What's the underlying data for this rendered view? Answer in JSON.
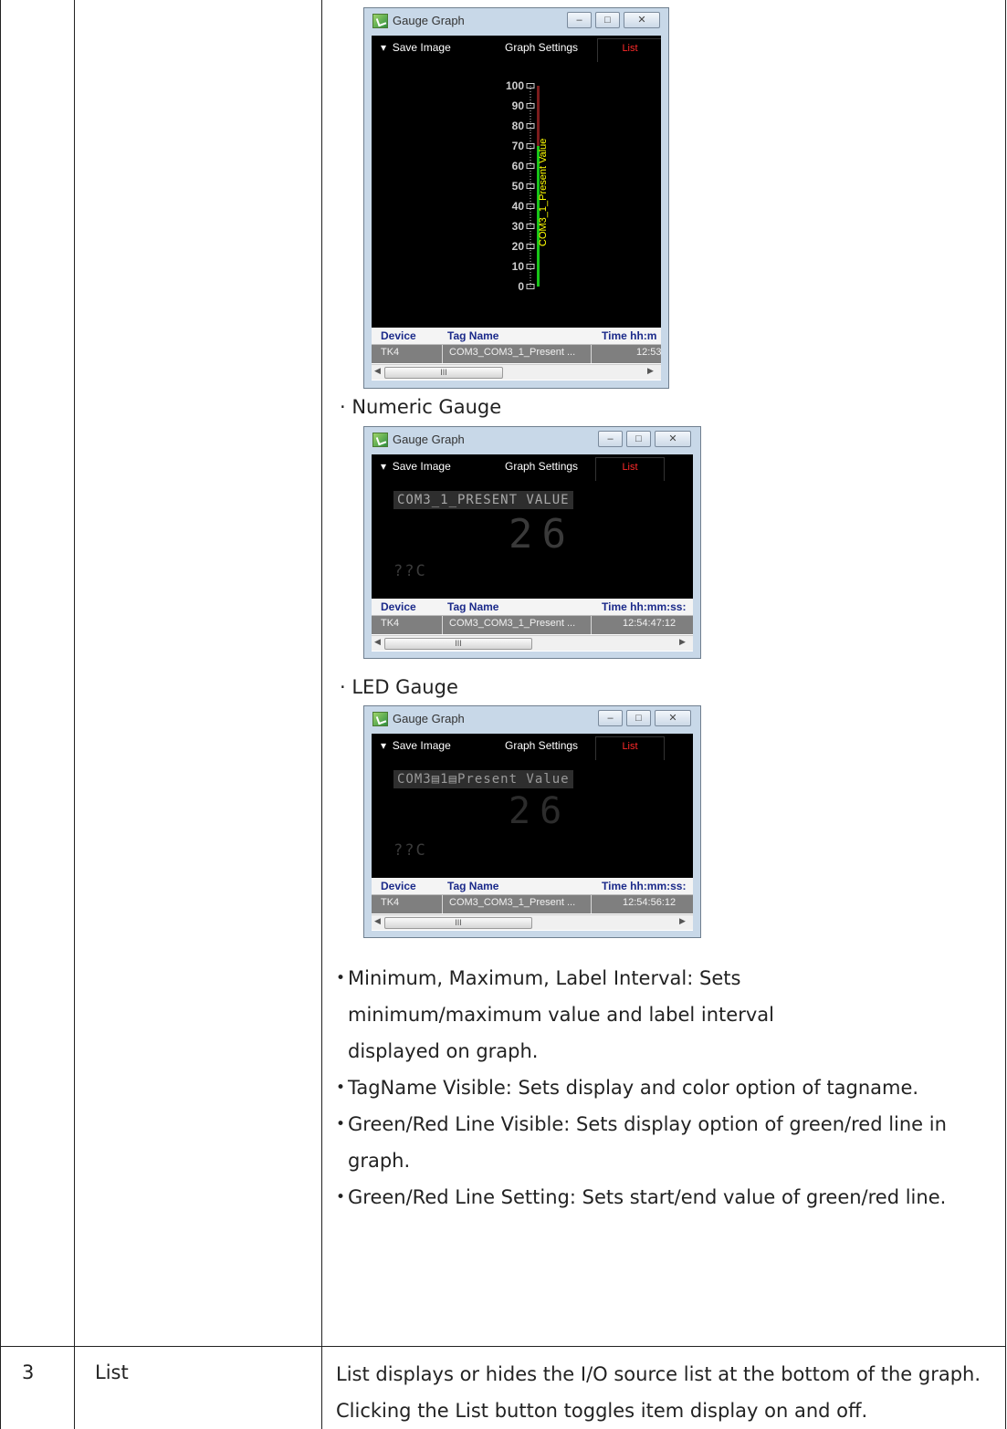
{
  "windows": {
    "title": "Gauge Graph",
    "save_image": "Save Image",
    "graph_settings": "Graph Settings",
    "list_tab": "List",
    "minimize": "–",
    "maximize": "□",
    "close": "✕",
    "col_device": "Device",
    "col_tag": "Tag Name",
    "scroll_thumb": "III",
    "scroll_left": "◀",
    "scroll_right": "▶"
  },
  "bar_gauge": {
    "tick_labels": [
      "100",
      "90",
      "80",
      "70",
      "60",
      "50",
      "40",
      "30",
      "20",
      "10",
      "0"
    ],
    "tag_label": "COM3_1_Present Value",
    "min": 0,
    "max": 100,
    "label_interval": 10,
    "green_line": {
      "start": 0,
      "end": 70
    },
    "red_line": {
      "start": 70,
      "end": 100
    },
    "col_time": "Time hh:m",
    "row": {
      "device": "TK4",
      "tag": "COM3_COM3_1_Present ...",
      "time": "12:53"
    }
  },
  "numeric_gauge": {
    "label": "· Numeric Gauge",
    "tag_display": "COM3_1_PRESENT VALUE",
    "value": "26",
    "unit": "??C",
    "col_time": "Time hh:mm:ss:",
    "row": {
      "device": "TK4",
      "tag": "COM3_COM3_1_Present ...",
      "time": "12:54:47:12"
    }
  },
  "led_gauge": {
    "label": "· LED Gauge",
    "tag_display": "COM3▤1▤Present Value",
    "value": "26",
    "unit": "??C",
    "col_time": "Time hh:mm:ss:",
    "row": {
      "device": "TK4",
      "tag": "COM3_COM3_1_Present ...",
      "time": "12:54:56:12"
    }
  },
  "bullets": [
    "Minimum, Maximum, Label Interval: Sets minimum/maximum value and label interval displayed on graph.",
    "TagName Visible: Sets display and color option of tagname.",
    "Green/Red Line Visible: Sets display option of green/red line in graph.",
    "Green/Red Line Setting: Sets start/end value of green/red line."
  ],
  "row3": {
    "number": "3",
    "name": "List",
    "description": "List displays or hides the I/O source list at the bottom of the graph. Clicking the List button toggles item display on and off."
  },
  "colors": {
    "green_line": "#19c419",
    "red_line": "#7a1c1c",
    "tag_text": "#ffff00",
    "list_header_text": "#1b2a8a",
    "list_tab": "#ff2a2a"
  }
}
